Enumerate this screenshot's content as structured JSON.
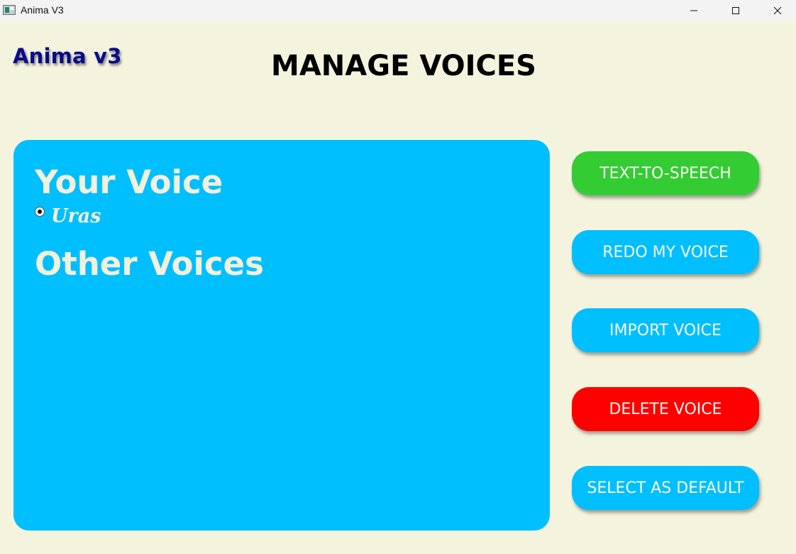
{
  "window": {
    "title": "Anima V3",
    "controls": [
      "minimize-icon",
      "maximize-icon",
      "close-icon"
    ]
  },
  "header": {
    "brand": "Anima v3",
    "page_title": "MANAGE VOICES"
  },
  "panel": {
    "your_voice_heading": "Your Voice",
    "your_voices": [
      {
        "name": "Uras",
        "selected": true
      }
    ],
    "other_voices_heading": "Other Voices",
    "other_voices": []
  },
  "actions": [
    {
      "label": "TEXT-TO-SPEECH",
      "color": "#33cc33"
    },
    {
      "label": "REDO MY VOICE",
      "color": "#00bfff"
    },
    {
      "label": "IMPORT VOICE",
      "color": "#00bfff"
    },
    {
      "label": "DELETE VOICE",
      "color": "#ff0000"
    },
    {
      "label": "SELECT AS DEFAULT",
      "color": "#00bfff"
    }
  ],
  "colors": {
    "background": "#f4f4de",
    "panel": "#00bfff",
    "brand": "#0a0a8c",
    "panel_text": "#f4f0dc"
  }
}
